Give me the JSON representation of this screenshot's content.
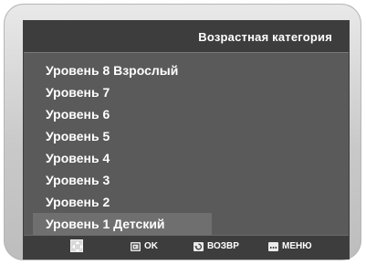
{
  "header": {
    "title": "Возрастная категория"
  },
  "menu": {
    "items": [
      {
        "label": "Уровень 8 Взрослый",
        "selected": false
      },
      {
        "label": "Уровень 7",
        "selected": false
      },
      {
        "label": "Уровень 6",
        "selected": false
      },
      {
        "label": "Уровень 5",
        "selected": false
      },
      {
        "label": "Уровень 4",
        "selected": false
      },
      {
        "label": "Уровень 3",
        "selected": false
      },
      {
        "label": "Уровень 2",
        "selected": false
      },
      {
        "label": "Уровень 1 Детский",
        "selected": true
      }
    ]
  },
  "footer": {
    "ok_label": "OK",
    "back_label": "ВОЗВР",
    "menu_label": "МЕНЮ",
    "icons": [
      "navigate-arrows-icon",
      "ok-icon",
      "return-icon",
      "menu-icon"
    ]
  },
  "colors": {
    "screen_bg": "#5a5a5a",
    "bar_bg": "#3d3d3d",
    "highlight": "#6f6f6f",
    "text": "#ffffff"
  }
}
